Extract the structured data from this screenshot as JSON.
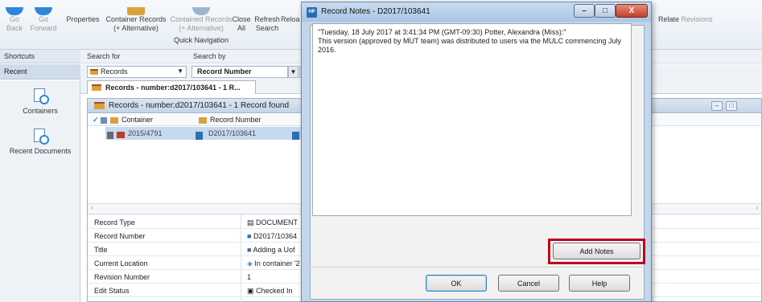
{
  "ribbon": {
    "go_back": {
      "top": "Go",
      "bottom": "Back"
    },
    "go_forward": {
      "top": "Go",
      "bottom": "Forward"
    },
    "properties": "Properties",
    "container_records": {
      "top": "Container Records",
      "bottom": "(+ Alternative)"
    },
    "contained_records": {
      "top": "Contained Records",
      "bottom": "(+ Alternative)"
    },
    "close_all": {
      "top": "Close",
      "bottom": "All"
    },
    "refresh_search": {
      "top": "Refresh",
      "bottom": "Search"
    },
    "reload": "Reloa",
    "group_label": "Quick Navigation",
    "relate": "Relate",
    "revisions": "Revisions"
  },
  "nav": {
    "shortcuts": "Shortcuts",
    "recent": "Recent",
    "containers": "Containers",
    "recent_documents": "Recent Documents"
  },
  "search": {
    "search_for_label": "Search for",
    "search_by_label": "Search by",
    "search_for_value": "Records",
    "search_by_value": "Record Number"
  },
  "tab": {
    "label": "Records - number:d2017/103641 - 1 R..."
  },
  "inner": {
    "title": "Records - number:d2017/103641 - 1 Record found",
    "col_container": "Container",
    "col_record_number": "Record Number",
    "row": {
      "container": "2015/4791",
      "record_number": "D2017/103641"
    }
  },
  "properties": [
    {
      "key": "Record Type",
      "value": "DOCUMENT"
    },
    {
      "key": "Record Number",
      "value": "D2017/10364"
    },
    {
      "key": "Title",
      "value": "Adding a Uof"
    },
    {
      "key": "Current Location",
      "value": "In container '2"
    },
    {
      "key": "Revision Number",
      "value": "1"
    },
    {
      "key": "Edit Status",
      "value": "Checked In"
    }
  ],
  "dialog": {
    "title": "Record Notes - D2017/103641",
    "note_line1": "\"Tuesday, 18 July 2017 at 3:41:34 PM (GMT-09:30)   Potter, Alexandra (Miss):\"",
    "note_line2": "This version (approved by MUT team) was distributed to users via the MULC commencing July 2016.",
    "add_notes": "Add Notes",
    "ok": "OK",
    "cancel": "Cancel",
    "help": "Help",
    "close_glyph": "X",
    "minimize_glyph": "–",
    "maximize_glyph": "□"
  },
  "colors": {
    "highlight": "#c0001c",
    "folder": "#d8a23a",
    "selection": "#c7d9ee",
    "dialog_frame": "#c2d6ec"
  }
}
